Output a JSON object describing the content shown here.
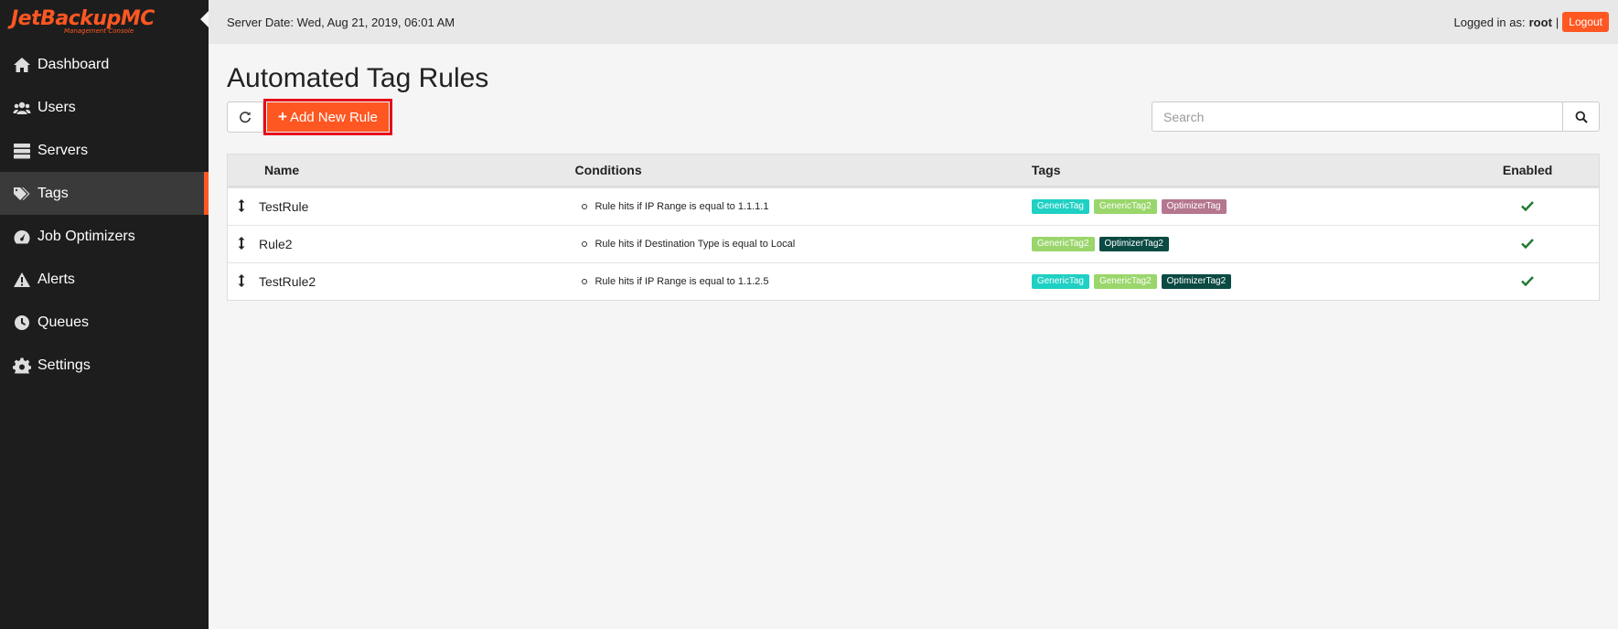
{
  "brand": {
    "logo_text": "JetBackupMC",
    "logo_subtext": "Management Console"
  },
  "sidebar": {
    "items": [
      {
        "label": "Dashboard",
        "icon": "home-icon",
        "active": false
      },
      {
        "label": "Users",
        "icon": "users-icon",
        "active": false
      },
      {
        "label": "Servers",
        "icon": "servers-icon",
        "active": false
      },
      {
        "label": "Tags",
        "icon": "tags-icon",
        "active": true
      },
      {
        "label": "Job Optimizers",
        "icon": "dashboard-gauge-icon",
        "active": false
      },
      {
        "label": "Alerts",
        "icon": "warning-icon",
        "active": false
      },
      {
        "label": "Queues",
        "icon": "clock-icon",
        "active": false
      },
      {
        "label": "Settings",
        "icon": "gear-icon",
        "active": false
      }
    ]
  },
  "header": {
    "server_date": "Server Date: Wed, Aug 21, 2019, 06:01 AM",
    "logged_in_label": "Logged in as:",
    "username": "root",
    "separator": "|",
    "logout_label": "Logout"
  },
  "page": {
    "title": "Automated Tag Rules",
    "add_button_label": "Add New Rule",
    "search_placeholder": "Search"
  },
  "table": {
    "headers": {
      "name": "Name",
      "conditions": "Conditions",
      "tags": "Tags",
      "enabled": "Enabled"
    },
    "rows": [
      {
        "name": "TestRule",
        "condition": "Rule hits if IP Range is equal to 1.1.1.1",
        "tags": [
          {
            "label": "GenericTag",
            "color": "#1fd0c4"
          },
          {
            "label": "GenericTag2",
            "color": "#9ad66b"
          },
          {
            "label": "OptimizerTag",
            "color": "#b5768f"
          }
        ],
        "enabled": true
      },
      {
        "name": "Rule2",
        "condition": "Rule hits if Destination Type is equal to Local",
        "tags": [
          {
            "label": "GenericTag2",
            "color": "#9ad66b"
          },
          {
            "label": "OptimizerTag2",
            "color": "#0b4a42"
          }
        ],
        "enabled": true
      },
      {
        "name": "TestRule2",
        "condition": "Rule hits if IP Range is equal to 1.1.2.5",
        "tags": [
          {
            "label": "GenericTag",
            "color": "#1fd0c4"
          },
          {
            "label": "GenericTag2",
            "color": "#9ad66b"
          },
          {
            "label": "OptimizerTag2",
            "color": "#0b4a42"
          }
        ],
        "enabled": true
      }
    ]
  },
  "colors": {
    "accent": "#ff5722",
    "highlight_border": "#e3101b",
    "check": "#1f7a2e",
    "sidebar_bg": "#1d1d1d"
  }
}
